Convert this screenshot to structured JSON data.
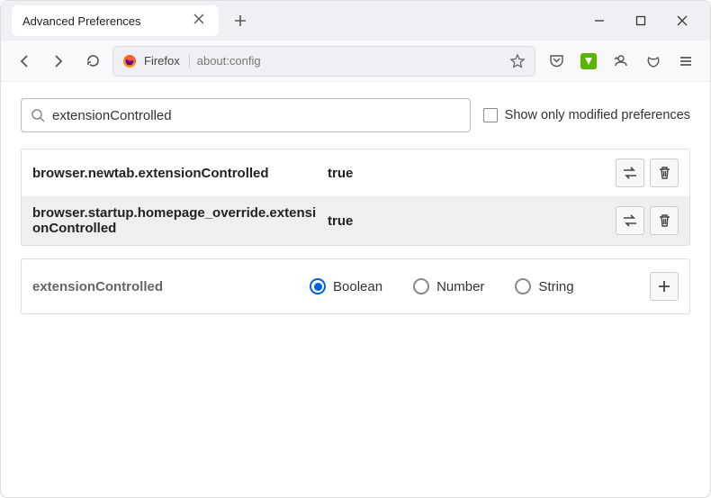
{
  "tab": {
    "title": "Advanced Preferences"
  },
  "urlbar": {
    "identity": "Firefox",
    "url": "about:config"
  },
  "content": {
    "search_value": "extensionControlled",
    "show_modified_label": "Show only modified preferences",
    "prefs": [
      {
        "name": "browser.newtab.extensionControlled",
        "value": "true"
      },
      {
        "name": "browser.startup.homepage_override.extensionControlled",
        "value": "true"
      }
    ],
    "new_pref": {
      "name": "extensionControlled",
      "types": [
        "Boolean",
        "Number",
        "String"
      ],
      "selected": 0
    }
  }
}
